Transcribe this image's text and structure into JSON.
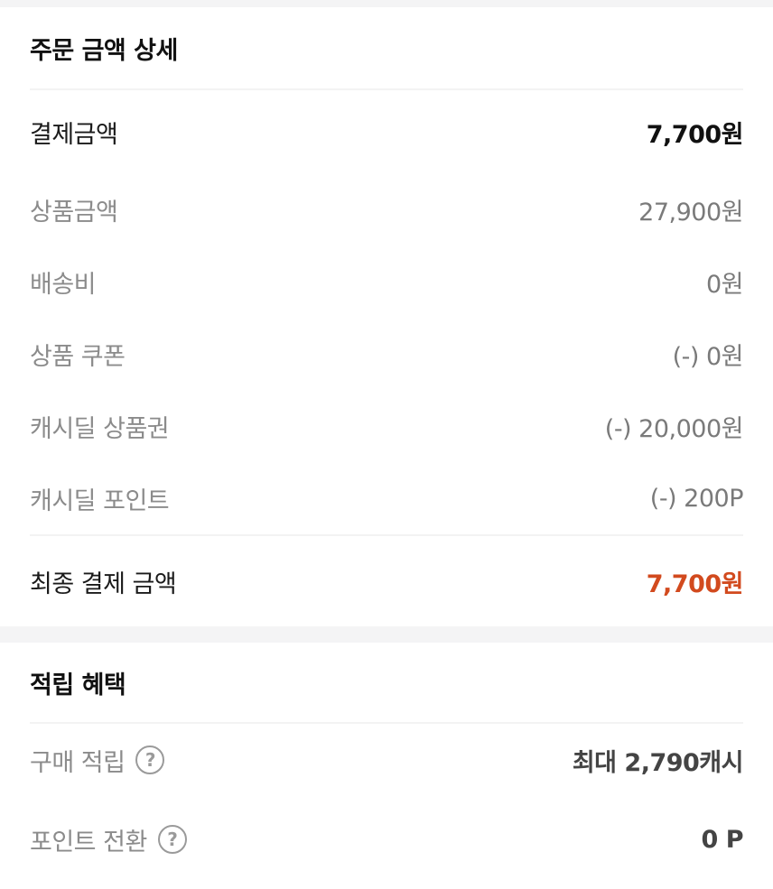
{
  "order_summary": {
    "title": "주문 금액 상세",
    "payment_amount": {
      "label": "결제금액",
      "value": "7,700원"
    },
    "items": [
      {
        "label": "상품금액",
        "value": "27,900원"
      },
      {
        "label": "배송비",
        "value": "0원"
      },
      {
        "label": "상품 쿠폰",
        "value": "(-) 0원"
      },
      {
        "label": "캐시딜 상품권",
        "value": "(-) 20,000원"
      },
      {
        "label": "캐시딜 포인트",
        "value": "(-) 200P"
      }
    ],
    "final": {
      "label": "최종 결제 금액",
      "value": "7,700원"
    }
  },
  "rewards": {
    "title": "적립 혜택",
    "purchase": {
      "label": "구매 적립",
      "value": "최대 2,790캐시"
    },
    "point_conversion": {
      "label": "포인트 전환",
      "value": "0 P"
    },
    "help_icon_glyph": "?"
  },
  "colors": {
    "accent": "#d24a1e",
    "muted_text": "#8b8b8b",
    "background_band": "#f4f4f5"
  },
  "icons": {
    "help": "question-circle-icon"
  }
}
